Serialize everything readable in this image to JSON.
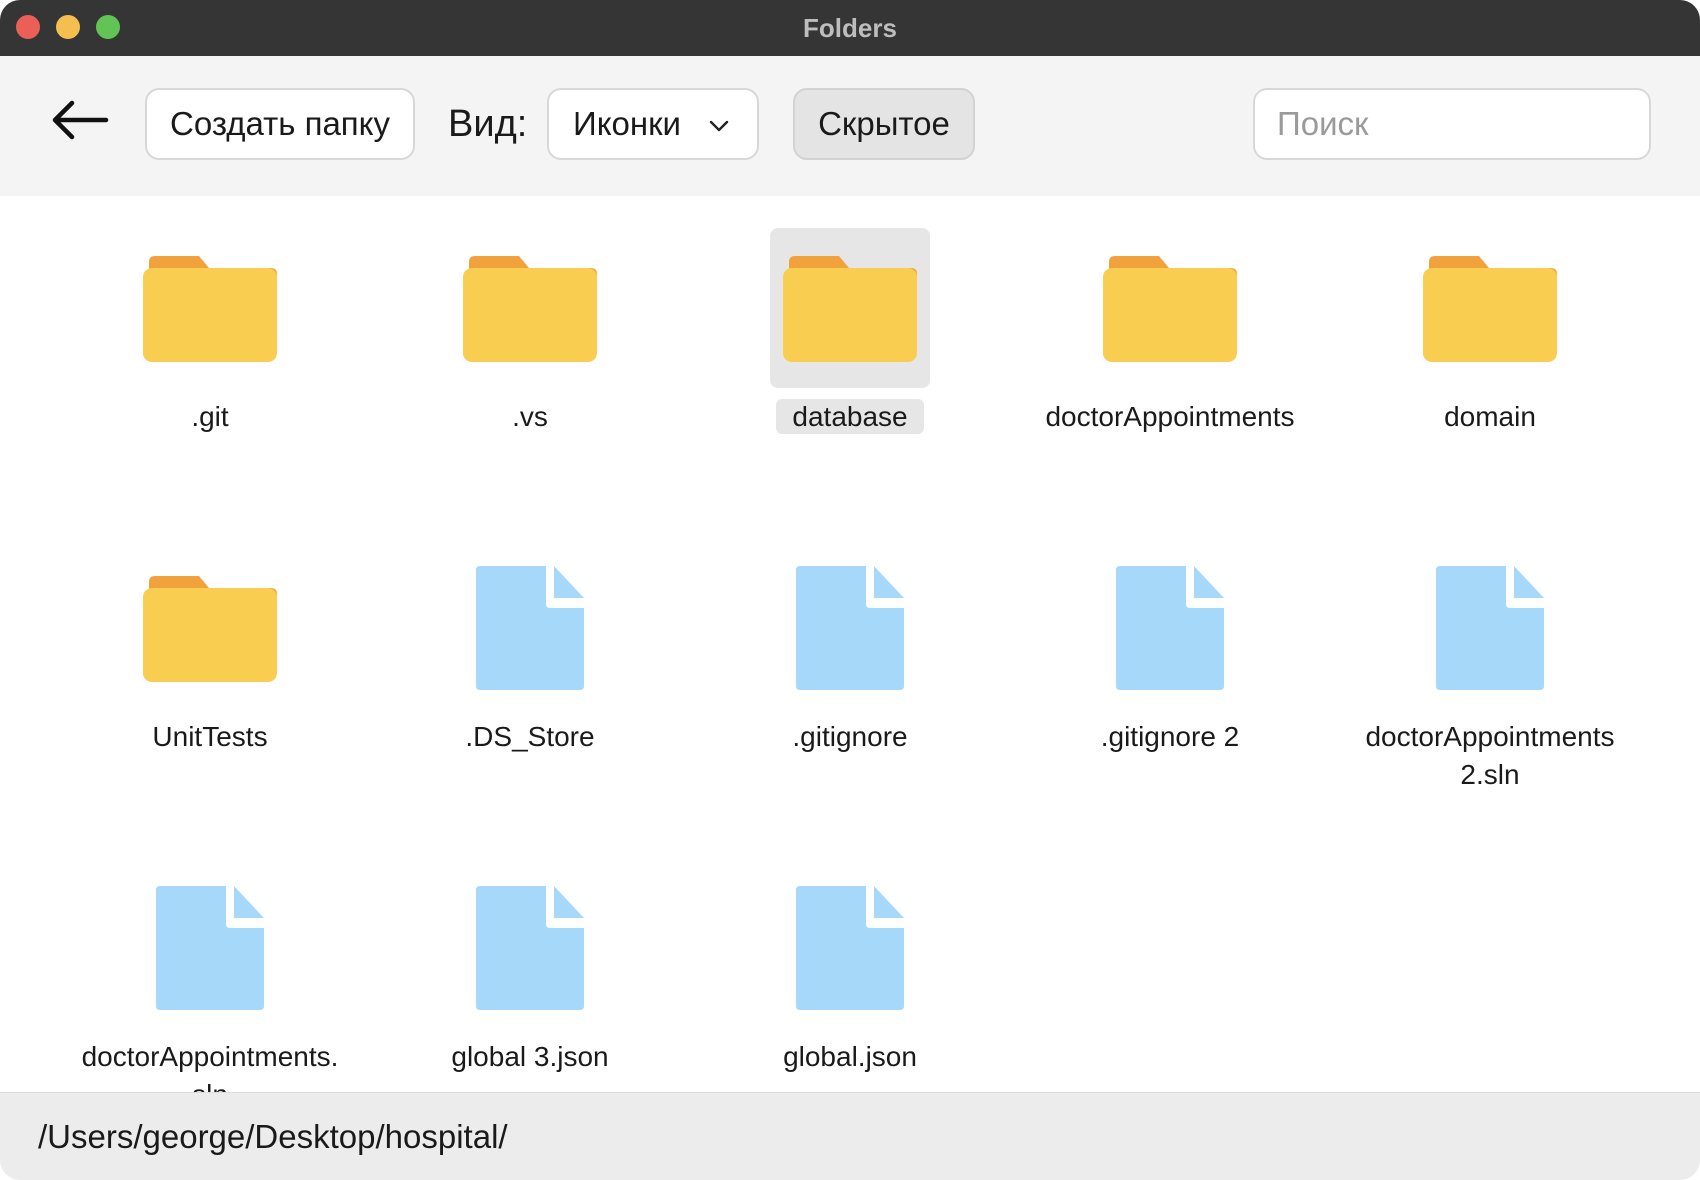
{
  "window": {
    "title": "Folders"
  },
  "toolbar": {
    "back_icon": "arrow-left-icon",
    "create_folder_label": "Создать папку",
    "view_label": "Вид:",
    "view_selected": "Иконки",
    "hidden_label": "Скрытое",
    "search_placeholder": "Поиск",
    "search_value": ""
  },
  "items": [
    {
      "name": ".git",
      "kind": "folder",
      "selected": false
    },
    {
      "name": ".vs",
      "kind": "folder",
      "selected": false
    },
    {
      "name": "database",
      "kind": "folder",
      "selected": true
    },
    {
      "name": "doctorAppointments",
      "kind": "folder",
      "selected": false
    },
    {
      "name": "domain",
      "kind": "folder",
      "selected": false
    },
    {
      "name": "UnitTests",
      "kind": "folder",
      "selected": false
    },
    {
      "name": ".DS_Store",
      "kind": "file",
      "selected": false
    },
    {
      "name": ".gitignore",
      "kind": "file",
      "selected": false
    },
    {
      "name": ".gitignore 2",
      "kind": "file",
      "selected": false
    },
    {
      "name": "doctorAppointments 2.sln",
      "kind": "file",
      "selected": false
    },
    {
      "name": "doctorAppointments.sln",
      "kind": "file",
      "selected": false
    },
    {
      "name": "global 3.json",
      "kind": "file",
      "selected": false
    },
    {
      "name": "global.json",
      "kind": "file",
      "selected": false
    }
  ],
  "status": {
    "path": "/Users/george/Desktop/hospital/"
  },
  "colors": {
    "folder_front": "#f8cd50",
    "folder_back": "#f2a23c",
    "file": "#a6d8fa",
    "selected_bg": "#e6e6e6"
  }
}
